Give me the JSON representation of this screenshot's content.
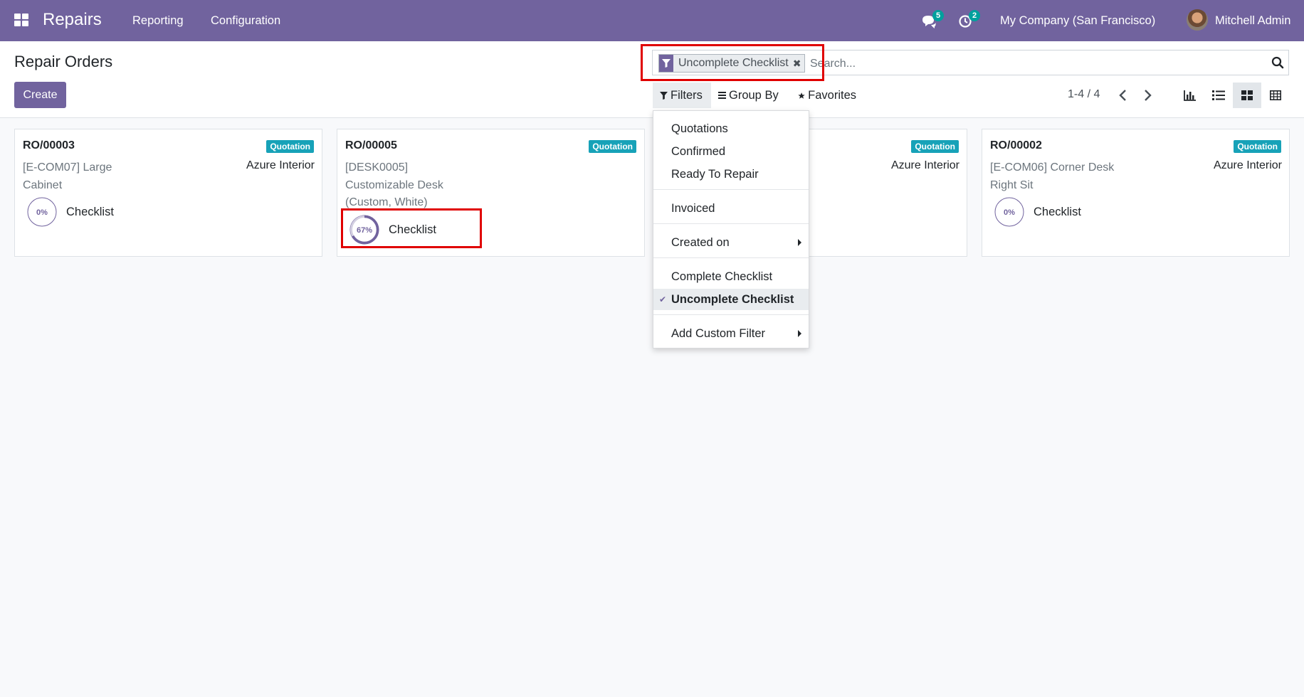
{
  "navbar": {
    "app_name": "Repairs",
    "menu": [
      "Reporting",
      "Configuration"
    ],
    "messages_count": "5",
    "activities_count": "2",
    "company": "My Company (San Francisco)",
    "user": "Mitchell Admin",
    "accent_color": "#71639e"
  },
  "control_panel": {
    "title": "Repair Orders",
    "create_label": "Create",
    "search": {
      "facet_label": "Uncomplete Checklist",
      "facet_remove": "✖",
      "placeholder": "Search..."
    },
    "filters_label": "Filters",
    "groupby_label": "Group By",
    "favorites_label": "Favorites",
    "pager": "1-4 / 4",
    "views": [
      "graph-view",
      "list-view",
      "kanban-view",
      "pivot-view"
    ],
    "active_view": "kanban-view"
  },
  "filters_dropdown": {
    "items": [
      {
        "label": "Quotations"
      },
      {
        "label": "Confirmed"
      },
      {
        "label": "Ready To Repair"
      },
      {
        "label": "Invoiced"
      },
      {
        "label": "Created on",
        "submenu": true
      },
      {
        "label": "Complete Checklist"
      },
      {
        "label": "Uncomplete Checklist",
        "selected": true
      },
      {
        "label": "Add Custom Filter",
        "submenu": true
      }
    ]
  },
  "cards": [
    {
      "ref": "RO/00003",
      "state": "Quotation",
      "product_line1": "[E-COM07] Large",
      "product_line2": "Cabinet",
      "product_line3": "",
      "partner": "Azure Interior",
      "progress_label": "0%",
      "progress": 0,
      "checklist_label": "Checklist"
    },
    {
      "ref": "RO/00005",
      "state": "Quotation",
      "product_line1": "[DESK0005]",
      "product_line2": "Customizable Desk",
      "product_line3": "(Custom, White)",
      "partner": "",
      "progress_label": "67%",
      "progress": 67,
      "checklist_label": "Checklist"
    },
    {
      "ref": "",
      "state": "Quotation",
      "product_line1": "",
      "product_line2": "",
      "product_line3": "",
      "partner": "Azure Interior",
      "progress_label": "",
      "progress": 0,
      "checklist_label": ""
    },
    {
      "ref": "RO/00002",
      "state": "Quotation",
      "product_line1": "[E-COM06] Corner Desk",
      "product_line2": "Right Sit",
      "product_line3": "",
      "partner": "Azure Interior",
      "progress_label": "0%",
      "progress": 0,
      "checklist_label": "Checklist"
    }
  ],
  "colors": {
    "quotation_badge": "#17a2b8",
    "highlight": "#e00000",
    "badge": "#00a09d"
  }
}
